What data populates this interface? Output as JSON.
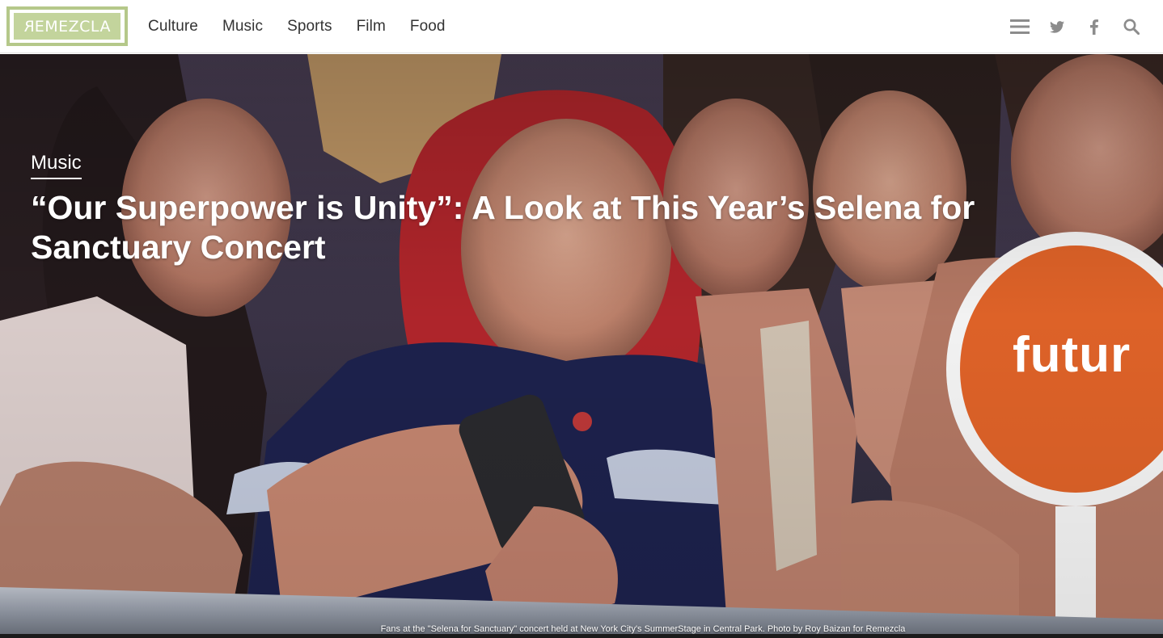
{
  "header": {
    "logo_text": "REMEZCLA",
    "logo_mirror_char": "R",
    "logo_rest": "EMEZCLA",
    "nav": [
      {
        "label": "Culture"
      },
      {
        "label": "Music"
      },
      {
        "label": "Sports"
      },
      {
        "label": "Film"
      },
      {
        "label": "Food"
      }
    ],
    "icons": [
      "menu-icon",
      "twitter-icon",
      "facebook-icon",
      "search-icon"
    ]
  },
  "hero": {
    "category": "Music",
    "headline": "“Our Superpower is Unity”: A Look at This Year’s Selena for Sanctuary Concert",
    "sign_text": "futur",
    "caption": "Fans at the \"Selena for Sanctuary\" concert held at New York City's SummerStage in Central Park. Photo by Roy Baizan for Remezcla"
  },
  "colors": {
    "logo_green": "#b5c88a",
    "nav_text": "#333333",
    "icon_gray": "#8c8c8c",
    "sign_orange": "#e9672a"
  }
}
